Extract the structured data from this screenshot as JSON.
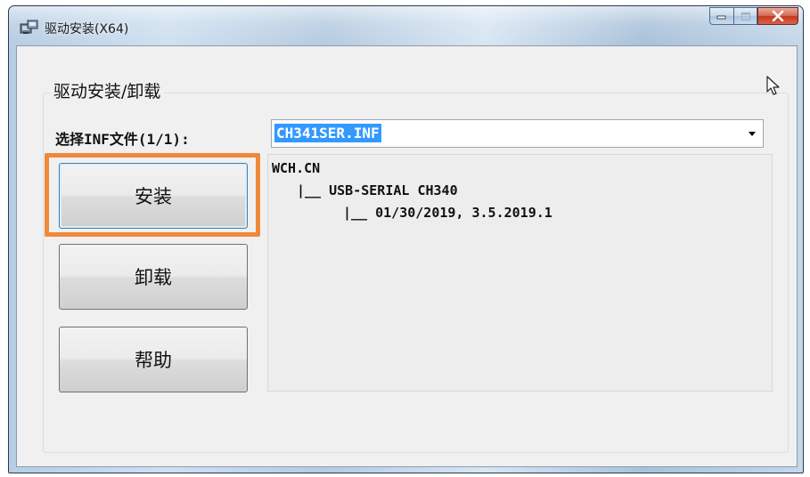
{
  "window": {
    "title": "驱动安装(X64)",
    "icon": "installer-icon",
    "controls": [
      "minimize-icon",
      "maximize-icon",
      "close-icon"
    ]
  },
  "group": {
    "title": "驱动安装/卸载"
  },
  "inf_select": {
    "label": "选择INF文件(1/1):",
    "value": "CH341SER.INF"
  },
  "buttons": {
    "install": "安装",
    "uninstall": "卸载",
    "help": "帮助"
  },
  "info": {
    "lines": [
      "WCH.CN",
      "|__ USB-SERIAL CH340",
      "|__ 01/30/2019, 3.5.2019.1"
    ]
  },
  "colors": {
    "highlight": "#f0883a",
    "selection": "#3399ff"
  }
}
